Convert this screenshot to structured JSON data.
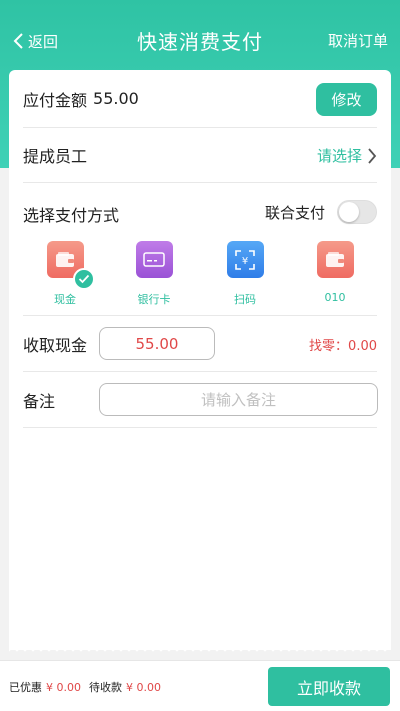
{
  "nav": {
    "back_label": "返回",
    "title": "快速消费支付",
    "cancel_label": "取消订单"
  },
  "amount": {
    "label": "应付金额",
    "value": "55.00",
    "modify_label": "修改"
  },
  "staff": {
    "label": "提成员工",
    "select_label": "请选择"
  },
  "payment": {
    "label": "选择支付方式",
    "combine_label": "联合支付",
    "combine_enabled": false,
    "methods": [
      {
        "label": "现金",
        "icon": "wallet-icon",
        "color": "#f2766a",
        "selected": true
      },
      {
        "label": "银行卡",
        "icon": "bank-card-icon",
        "color": "#a25ed8",
        "selected": false
      },
      {
        "label": "扫码",
        "icon": "scan-code-icon",
        "color": "#3d8ff0",
        "selected": false
      },
      {
        "label": "010",
        "icon": "wallet-icon",
        "color": "#f2766a",
        "selected": false
      }
    ]
  },
  "cash": {
    "label": "收取现金",
    "value": "55.00",
    "change_label": "找零：",
    "change_value": "0.00"
  },
  "remark": {
    "label": "备注",
    "placeholder": "请输入备注"
  },
  "footer": {
    "discount_label": "已优惠",
    "discount_value": "¥ 0.00",
    "pending_label": "待收款",
    "pending_value": "¥ 0.00",
    "collect_label": "立即收款"
  },
  "colors": {
    "accent": "#2fbfa0",
    "header": "#3cccb0",
    "danger": "#e04848"
  }
}
